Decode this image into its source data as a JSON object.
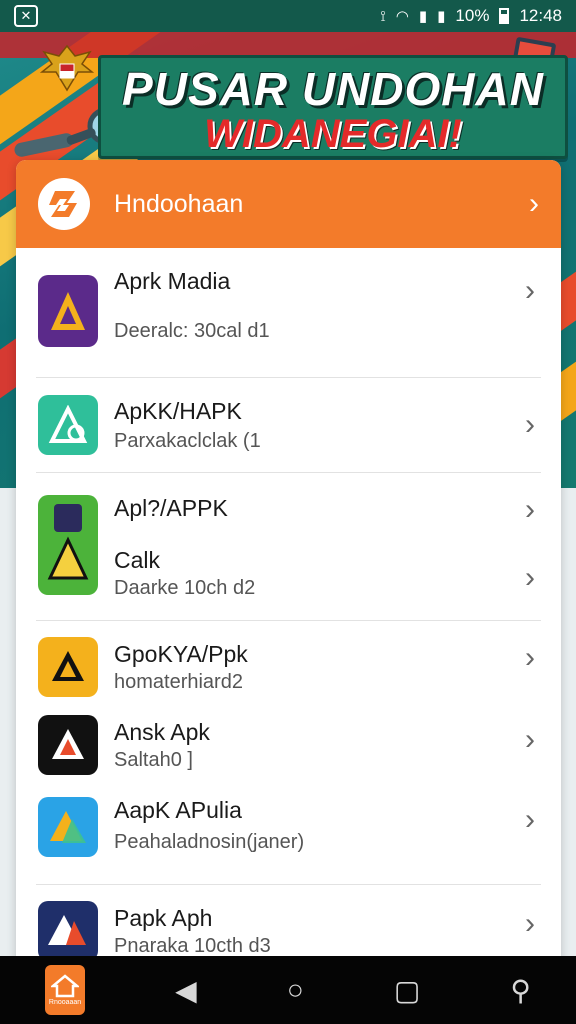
{
  "status_bar": {
    "battery": "10%",
    "time": "12:48"
  },
  "banner": {
    "title_line1": "PUSAR UNDOHAN",
    "title_line2": "WIDANEGIAI!"
  },
  "card": {
    "header_title": "Hndoohaan",
    "items": [
      {
        "title": "Aprk Madia",
        "subtitle": "Deeralc: 30cal d1",
        "icon_bg": "#5b2a8a"
      },
      {
        "title": "ApKK/HAPK",
        "subtitle": "Parxakaclclak (1",
        "icon_bg": "#2fbf9a"
      },
      {
        "title": "Apl?/APPK",
        "title2": "Calk",
        "subtitle": "Daarke 10ch d2",
        "icon_bg": "#4cb33a"
      },
      {
        "title": "GpoKYA/Ppk",
        "subtitle": "homaterhiard2",
        "icon_bg": "#f4b11c"
      },
      {
        "title": "Ansk Apk",
        "subtitle": "Saltah0 ]",
        "icon_bg": "#111111"
      },
      {
        "title": "AapK APulia",
        "subtitle": "Peahaladnosin(janer)",
        "icon_bg": "#2aa3e6"
      },
      {
        "title": "Papk Aph",
        "subtitle": "Pnaraka 10cth d3",
        "icon_bg": "#1f2f6a"
      }
    ]
  },
  "navbar": {
    "home_label": "Rnooaaan"
  },
  "colors": {
    "accent": "#f37b2a",
    "status_bar": "#13594b"
  }
}
